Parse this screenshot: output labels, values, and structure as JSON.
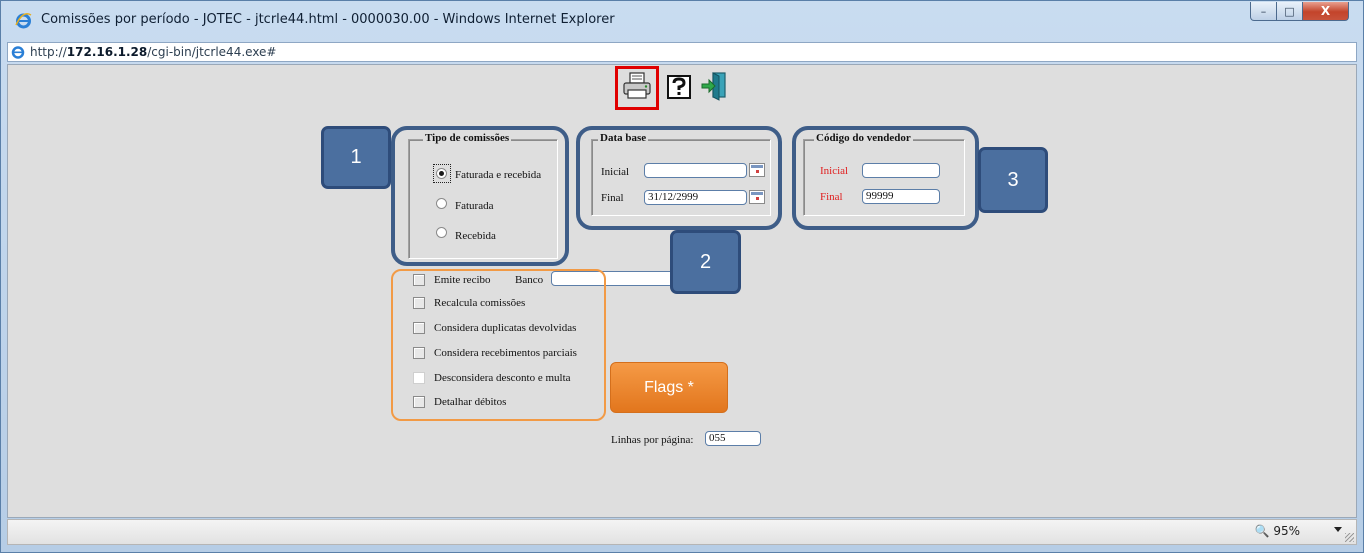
{
  "window": {
    "title": "Comissões por período - JOTEC - jtcrle44.html - 0000030.00 - Windows Internet Explorer",
    "min_label": "–",
    "max_label": "□",
    "close_label": "X"
  },
  "address": {
    "prefix": "http://",
    "host": "172.16.1.28",
    "path": "/cgi-bin/jtcrle44.exe#"
  },
  "toolbar": {
    "icons": [
      "printer-icon",
      "help-icon",
      "exit-icon"
    ]
  },
  "tipo_comissoes": {
    "legend": "Tipo de comissões",
    "options": [
      {
        "label": "Faturada e recebida",
        "selected": true
      },
      {
        "label": "Faturada",
        "selected": false
      },
      {
        "label": "Recebida",
        "selected": false
      }
    ]
  },
  "data_base": {
    "legend": "Data base",
    "inicial_label": "Inicial",
    "inicial_value": "",
    "final_label": "Final",
    "final_value": "31/12/2999"
  },
  "codigo_vendedor": {
    "legend": "Código do vendedor",
    "inicial_label": "Inicial",
    "inicial_value": "",
    "final_label": "Final",
    "final_value": "99999"
  },
  "flags": {
    "emite_recibo": "Emite recibo",
    "banco_label": "Banco",
    "banco_value": "",
    "recalcula": "Recalcula comissões",
    "duplicatas": "Considera duplicatas devolvidas",
    "recebimentos": "Considera recebimentos parciais",
    "desconsidera": "Desconsidera desconto e multa",
    "detalhar": "Detalhar débitos"
  },
  "linhas": {
    "label": "Linhas por página:",
    "value": "055"
  },
  "callouts": {
    "one": "1",
    "two": "2",
    "three": "3",
    "flags": "Flags *"
  },
  "status": {
    "zoom": "95%"
  },
  "colors": {
    "callout_blue": "#4b6f9f",
    "flags_orange": "#f08c34",
    "highlight_red": "#e00000",
    "required_label_red": "#e02020"
  }
}
